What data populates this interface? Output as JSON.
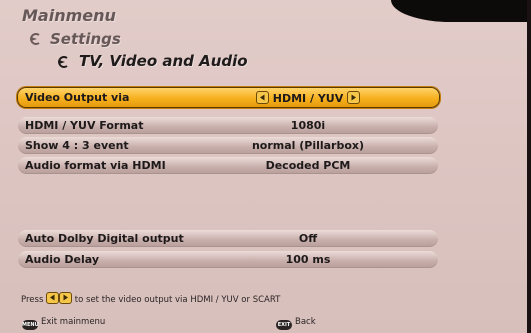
{
  "header": {
    "main_title": "Mainmenu",
    "sub_title": "Settings",
    "section_title": "TV, Video and Audio"
  },
  "settings": {
    "video_output": {
      "label": "Video Output via",
      "value": "HDMI / YUV"
    },
    "hdmi_format": {
      "label": "HDMI / YUV Format",
      "value": "1080i"
    },
    "show_43": {
      "label": "Show 4 : 3 event",
      "value": "normal (Pillarbox)"
    },
    "audio_format": {
      "label": "Audio format via HDMI",
      "value": "Decoded PCM"
    },
    "auto_dolby": {
      "label": "Auto Dolby Digital output",
      "value": "Off"
    },
    "audio_delay": {
      "label": "Audio Delay",
      "value": "100 ms"
    }
  },
  "hint": {
    "prefix": "Press",
    "suffix": "to set the video output via HDMI / YUV or SCART"
  },
  "footer": {
    "menu_key": "MENU",
    "menu_label": "Exit mainmenu",
    "exit_key": "EXIT",
    "exit_label": "Back"
  },
  "colors": {
    "background": "#dcc4c1",
    "selected_row": "#f6b01e",
    "row": "#c7aeab"
  }
}
